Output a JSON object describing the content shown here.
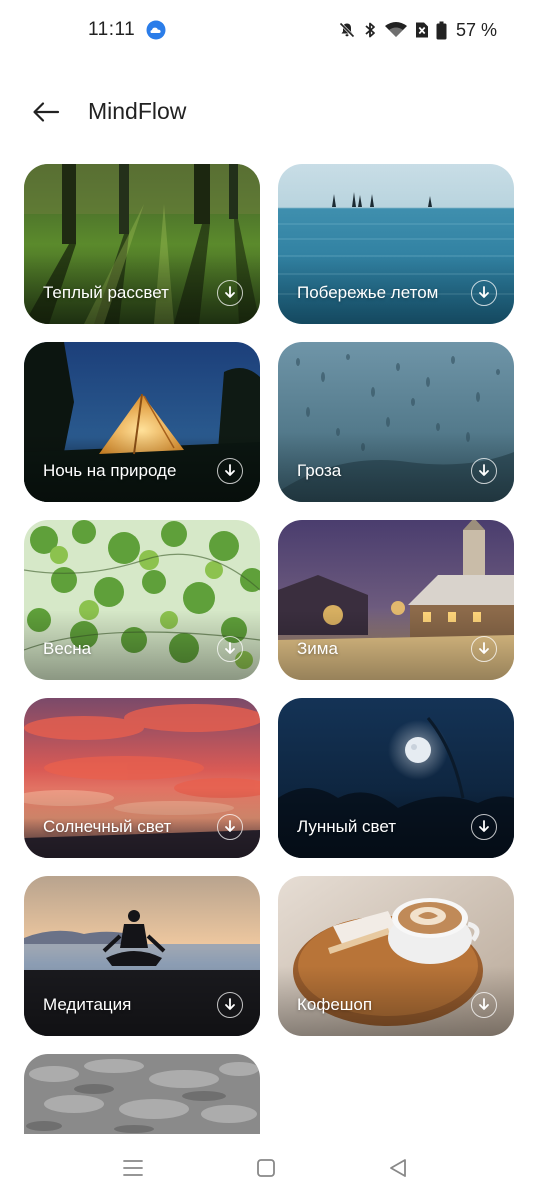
{
  "status": {
    "time": "11:11",
    "battery": "57 %"
  },
  "header": {
    "title": "MindFlow"
  },
  "cards": [
    {
      "label": "Теплый рассвет",
      "scene": "forest"
    },
    {
      "label": "Побережье летом",
      "scene": "sea"
    },
    {
      "label": "Ночь на природе",
      "scene": "tent"
    },
    {
      "label": "Гроза",
      "scene": "rain"
    },
    {
      "label": "Весна",
      "scene": "leaves"
    },
    {
      "label": "Зима",
      "scene": "winter-village"
    },
    {
      "label": "Солнечный свет",
      "scene": "sunset-clouds"
    },
    {
      "label": "Лунный свет",
      "scene": "moon"
    },
    {
      "label": "Медитация",
      "scene": "meditation"
    },
    {
      "label": "Кофешоп",
      "scene": "coffee"
    },
    {
      "label": "",
      "scene": "gray-texture"
    }
  ],
  "icons": {
    "back": "arrow-left-icon",
    "download": "download-icon",
    "nav": [
      "menu-icon",
      "home-icon",
      "back-triangle-icon"
    ]
  }
}
